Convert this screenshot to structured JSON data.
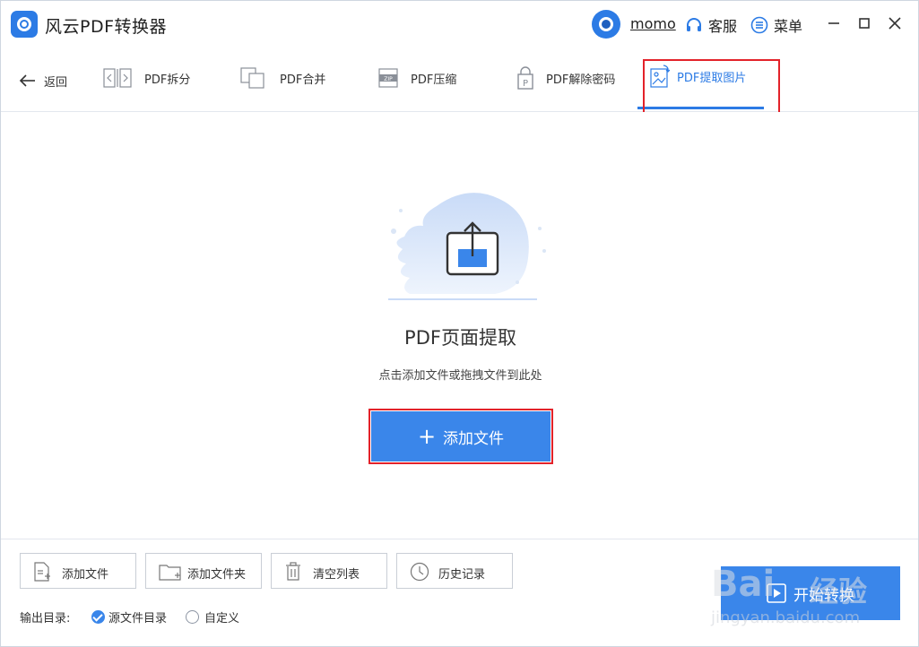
{
  "app": {
    "title": "风云PDF转换器",
    "brand_color": "#2c7be5"
  },
  "header": {
    "username": "momo",
    "service_label": "客服",
    "menu_label": "菜单"
  },
  "toolbar": {
    "back_label": "返回",
    "tools": [
      {
        "label": "PDF拆分",
        "icon": "split-icon"
      },
      {
        "label": "PDF合并",
        "icon": "merge-icon"
      },
      {
        "label": "PDF压缩",
        "icon": "zip-icon"
      },
      {
        "label": "PDF解除密码",
        "icon": "unlock-icon"
      },
      {
        "label": "PDF提取图片",
        "icon": "image-extract-icon",
        "active": true
      }
    ],
    "active_color": "#2c7be5"
  },
  "drop_area": {
    "title": "PDF页面提取",
    "hint": "点击添加文件或拖拽文件到此处",
    "add_button": "添加文件",
    "add_icon": "+"
  },
  "bottom": {
    "buttons": [
      {
        "label": "添加文件",
        "icon": "file-add-icon"
      },
      {
        "label": "添加文件夹",
        "icon": "folder-add-icon"
      },
      {
        "label": "清空列表",
        "icon": "trash-icon"
      },
      {
        "label": "历史记录",
        "icon": "clock-icon"
      }
    ],
    "output_label": "输出目录:",
    "output_options": [
      {
        "label": "源文件目录",
        "selected": true
      },
      {
        "label": "自定义",
        "selected": false
      }
    ],
    "convert_label": "开始转换"
  },
  "watermark": {
    "text1": "Bai",
    "text2": "经验",
    "text3": "jingyan.baidu.com"
  },
  "highlight_color": "#e3222a"
}
